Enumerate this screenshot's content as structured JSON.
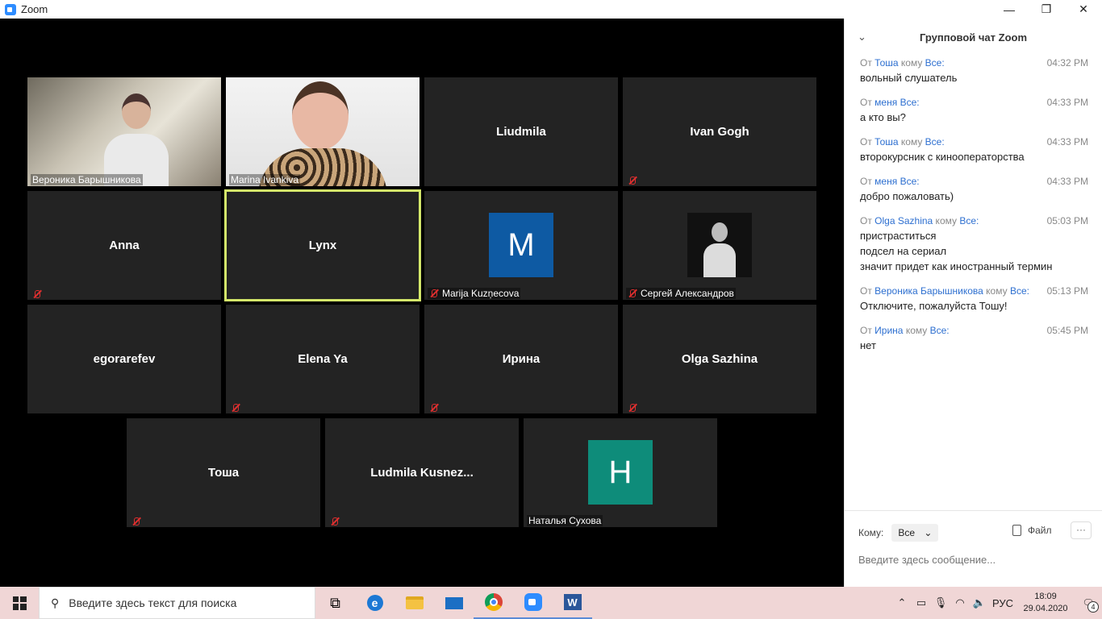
{
  "window": {
    "title": "Zoom",
    "minimize": "—",
    "maximize": "❐",
    "close": "✕"
  },
  "tiles": [
    {
      "name": "Вероника Барышникова",
      "display": "photo1",
      "muted": false
    },
    {
      "name": "Marina Ivankiva",
      "display": "photo2",
      "muted": false
    },
    {
      "name": "Liudmila",
      "display": "name",
      "muted": false
    },
    {
      "name": "Ivan Gogh",
      "display": "name",
      "muted": true
    },
    {
      "name": "Anna",
      "display": "name",
      "muted": true
    },
    {
      "name": "Lynx",
      "display": "name",
      "muted": false,
      "active": true
    },
    {
      "name": "Marija Kuzņecova",
      "display": "avatar",
      "letter": "M",
      "color": "#0e5aa3",
      "muted": true
    },
    {
      "name": "Сергей Александров",
      "display": "thumb",
      "muted": true
    },
    {
      "name": "egorarefev",
      "display": "name",
      "muted": false
    },
    {
      "name": "Elena Ya",
      "display": "name",
      "muted": true
    },
    {
      "name": "Ирина",
      "display": "name",
      "muted": true
    },
    {
      "name": "Olga Sazhina",
      "display": "name",
      "muted": true
    },
    {
      "name": "Тоша",
      "display": "name",
      "muted": true
    },
    {
      "name": "Ludmila  Kusnez...",
      "display": "name",
      "muted": true
    },
    {
      "name": "Наталья Сухова",
      "display": "avatar",
      "letter": "H",
      "color": "#0e8c7a",
      "muted": false
    }
  ],
  "chat": {
    "title": "Групповой чат Zoom",
    "collapse_icon": "⌄",
    "messages": [
      {
        "from_prefix": "От ",
        "sender": "Тоша",
        "to_prefix": " кому ",
        "recipient": "Все:",
        "time": "04:32 PM",
        "lines": [
          "вольный слушатель"
        ]
      },
      {
        "from_prefix": "От ",
        "sender": "меня",
        "to_prefix": " ",
        "recipient": "Все:",
        "time": "04:33 PM",
        "lines": [
          "а кто вы?"
        ]
      },
      {
        "from_prefix": "От ",
        "sender": "Тоша",
        "to_prefix": " кому ",
        "recipient": "Все:",
        "time": "04:33 PM",
        "lines": [
          "второкурсник с кинооператорства"
        ]
      },
      {
        "from_prefix": "От ",
        "sender": "меня",
        "to_prefix": " ",
        "recipient": "Все:",
        "time": "04:33 PM",
        "lines": [
          "добро пожаловать)"
        ]
      },
      {
        "from_prefix": "От ",
        "sender": "Olga Sazhina",
        "to_prefix": " кому ",
        "recipient": "Все:",
        "time": "05:03 PM",
        "lines": [
          "пристраститься",
          "подсел на сериал",
          "значит придет как иностранный термин"
        ]
      },
      {
        "from_prefix": "От ",
        "sender": "Вероника Барышникова",
        "to_prefix": " кому ",
        "recipient": "Все:",
        "time": "05:13 PM",
        "lines": [
          "Отключите, пожалуйста Тошу!"
        ]
      },
      {
        "from_prefix": "От ",
        "sender": "Ирина",
        "to_prefix": " кому ",
        "recipient": "Все:",
        "time": "05:45 PM",
        "lines": [
          "нет"
        ]
      }
    ],
    "to_label": "Кому:",
    "to_value": "Все",
    "file_label": "Файл",
    "more_label": "···",
    "input_placeholder": "Введите здесь сообщение..."
  },
  "taskbar": {
    "search_placeholder": "Введите здесь текст для поиска",
    "lang": "РУС",
    "time": "18:09",
    "date": "29.04.2020",
    "notif_count": "4"
  }
}
